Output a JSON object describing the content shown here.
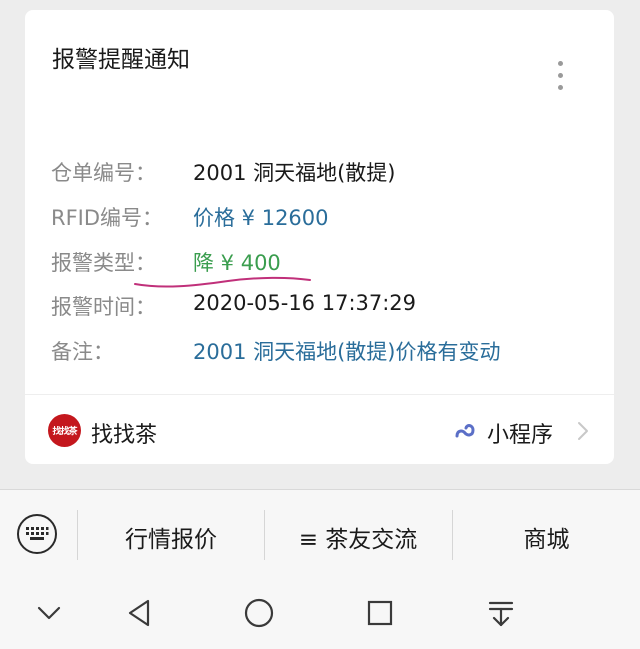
{
  "card": {
    "title": "报警提醒通知",
    "rows": [
      {
        "label": "仓单编号：",
        "value": "2001 洞天福地(散提)"
      },
      {
        "label": "RFID编号：",
        "value": "价格 ¥ 12600"
      },
      {
        "label": "报警类型：",
        "value": "降 ¥ 400"
      },
      {
        "label": "报警时间：",
        "value": "2020-05-16 17:37:29"
      },
      {
        "label": "备注：",
        "value": "2001 洞天福地(散提)价格有变动"
      }
    ],
    "footer": {
      "brand_logo_text": "找找茶",
      "brand_name": "找找茶",
      "mini_program_label": "小程序"
    }
  },
  "menu": {
    "items": [
      {
        "label": "行情报价"
      },
      {
        "label": "≡ 茶友交流"
      },
      {
        "label": "商城"
      }
    ]
  },
  "colors": {
    "value_blue": "#2a6d9a",
    "value_green": "#3a9d4e",
    "annotation_underline": "#c0307a",
    "brand_red": "#c4171d"
  }
}
